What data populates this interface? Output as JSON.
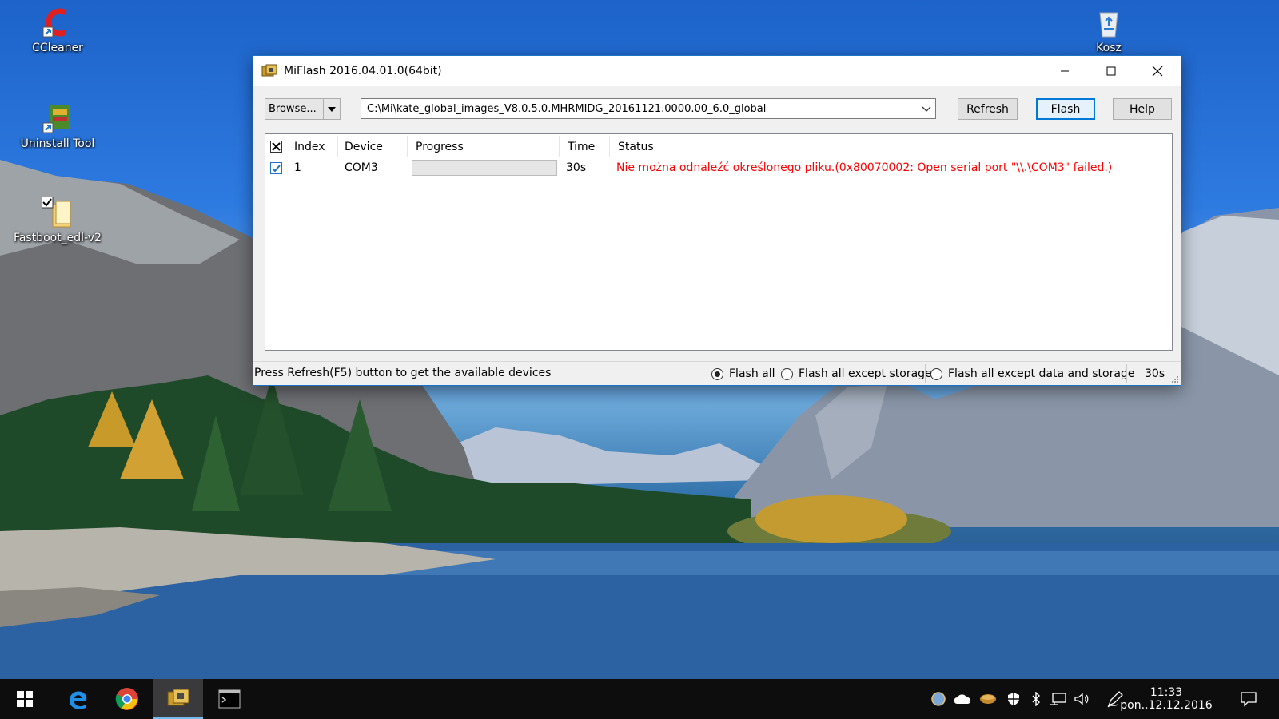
{
  "desktop": {
    "icons": [
      {
        "label": "CCleaner"
      },
      {
        "label": "Uninstall Tool"
      },
      {
        "label": "Fastboot_edl-v2"
      },
      {
        "label": "Kosz"
      }
    ]
  },
  "window": {
    "title": "MiFlash 2016.04.01.0(64bit)",
    "toolbar": {
      "browse_label": "Browse...",
      "path_value": "C:\\Mi\\kate_global_images_V8.0.5.0.MHRMIDG_20161121.0000.00_6.0_global",
      "refresh_label": "Refresh",
      "flash_label": "Flash",
      "help_label": "Help"
    },
    "grid": {
      "columns": [
        "Index",
        "Device",
        "Progress",
        "Time",
        "Status"
      ],
      "rows": [
        {
          "checked": true,
          "index": "1",
          "device": "COM3",
          "progress": 0,
          "time": "30s",
          "status": "Nie można odnaleźć określonego pliku.(0x80070002: Open serial port \"\\\\.\\COM3\" failed.)"
        }
      ]
    },
    "statusbar": {
      "message": "Press Refresh(F5) button to get the available devices",
      "options": [
        "Flash all",
        "Flash all except storage",
        "Flash all except data and storage"
      ],
      "selected_option": "Flash all",
      "timer": "30s"
    }
  },
  "taskbar": {
    "clock_time": "11:33",
    "clock_date": "pon..12.12.2016"
  },
  "colors": {
    "error_text": "#ff0000",
    "accent": "#0078d7",
    "taskbar": "#0d0d0e"
  }
}
